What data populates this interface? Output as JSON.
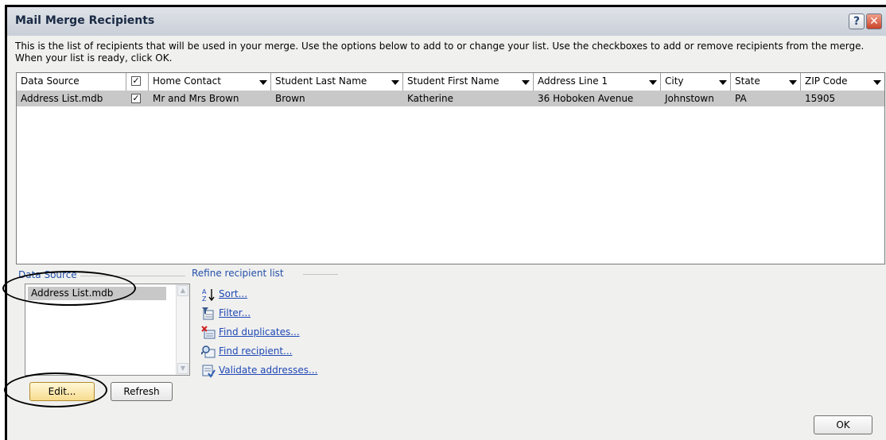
{
  "window": {
    "title": "Mail Merge Recipients",
    "help_glyph": "?",
    "close_glyph": "✕"
  },
  "description": "This is the list of recipients that will be used in your merge.  Use the options below to add to or change your list.  Use the checkboxes to add or remove recipients from the merge.  When your list is ready, click OK.",
  "grid": {
    "columns": [
      {
        "label": "Data Source",
        "dropdown": false
      },
      {
        "label": "",
        "checkbox": true,
        "dropdown": false
      },
      {
        "label": "Home Contact",
        "dropdown": true
      },
      {
        "label": "Student Last Name",
        "dropdown": true
      },
      {
        "label": "Student First Name",
        "dropdown": true
      },
      {
        "label": "Address Line 1",
        "dropdown": true
      },
      {
        "label": "City",
        "dropdown": true
      },
      {
        "label": "State",
        "dropdown": true
      },
      {
        "label": "ZIP Code",
        "dropdown": true
      }
    ],
    "rows": [
      {
        "data_source": "Address List.mdb",
        "checked": true,
        "home_contact": "Mr and Mrs Brown",
        "student_last_name": "Brown",
        "student_first_name": "Katherine",
        "address_line_1": "36 Hoboken Avenue",
        "city": "Johnstown",
        "state": "PA",
        "zip": "15905"
      }
    ]
  },
  "data_source_panel": {
    "label": "Data Source",
    "items": [
      "Address List.mdb"
    ],
    "edit_button": "Edit...",
    "refresh_button": "Refresh"
  },
  "refine": {
    "label": "Refine recipient list",
    "items": [
      {
        "label": "Sort...",
        "icon": "sort-az-icon"
      },
      {
        "label": "Filter...",
        "icon": "filter-icon"
      },
      {
        "label": "Find duplicates...",
        "icon": "find-duplicates-icon"
      },
      {
        "label": "Find recipient...",
        "icon": "find-recipient-icon"
      },
      {
        "label": "Validate addresses...",
        "icon": "validate-addresses-icon"
      }
    ]
  },
  "ok_button": "OK",
  "colors": {
    "link": "#1f48b4",
    "group_label": "#2450a8",
    "selection": "#c8c8c8"
  }
}
